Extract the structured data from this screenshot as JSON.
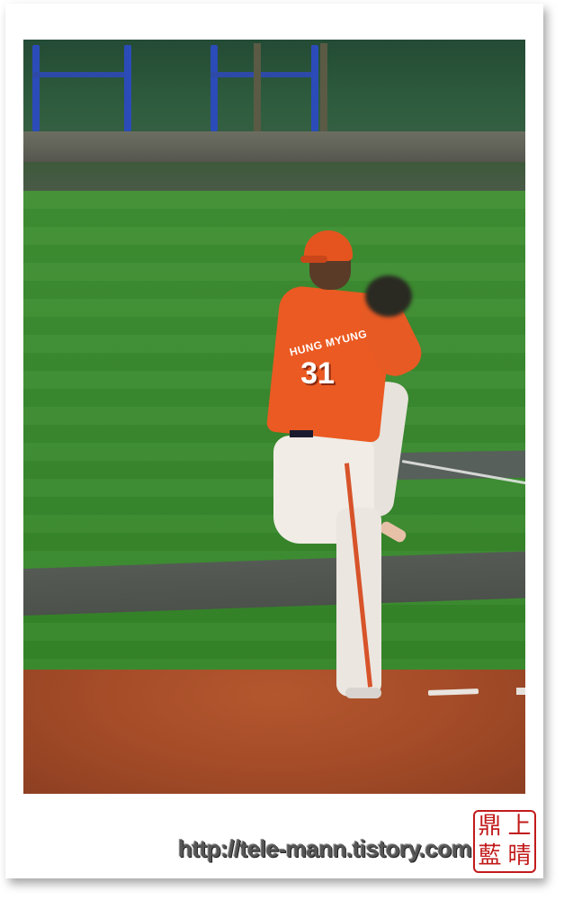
{
  "photo": {
    "subject": "baseball pitcher",
    "jersey_name": "HUNG MYUNG",
    "jersey_number": "31"
  },
  "watermark": {
    "url_text": "http://tele-mann.tistory.com"
  },
  "seal": {
    "chars": [
      "鼎",
      "上",
      "藍",
      "晴"
    ]
  },
  "colors": {
    "jersey": "#ea5a22",
    "grass": "#3a8a2f",
    "dirt": "#a54c28",
    "seal_red": "#c21b1b"
  }
}
